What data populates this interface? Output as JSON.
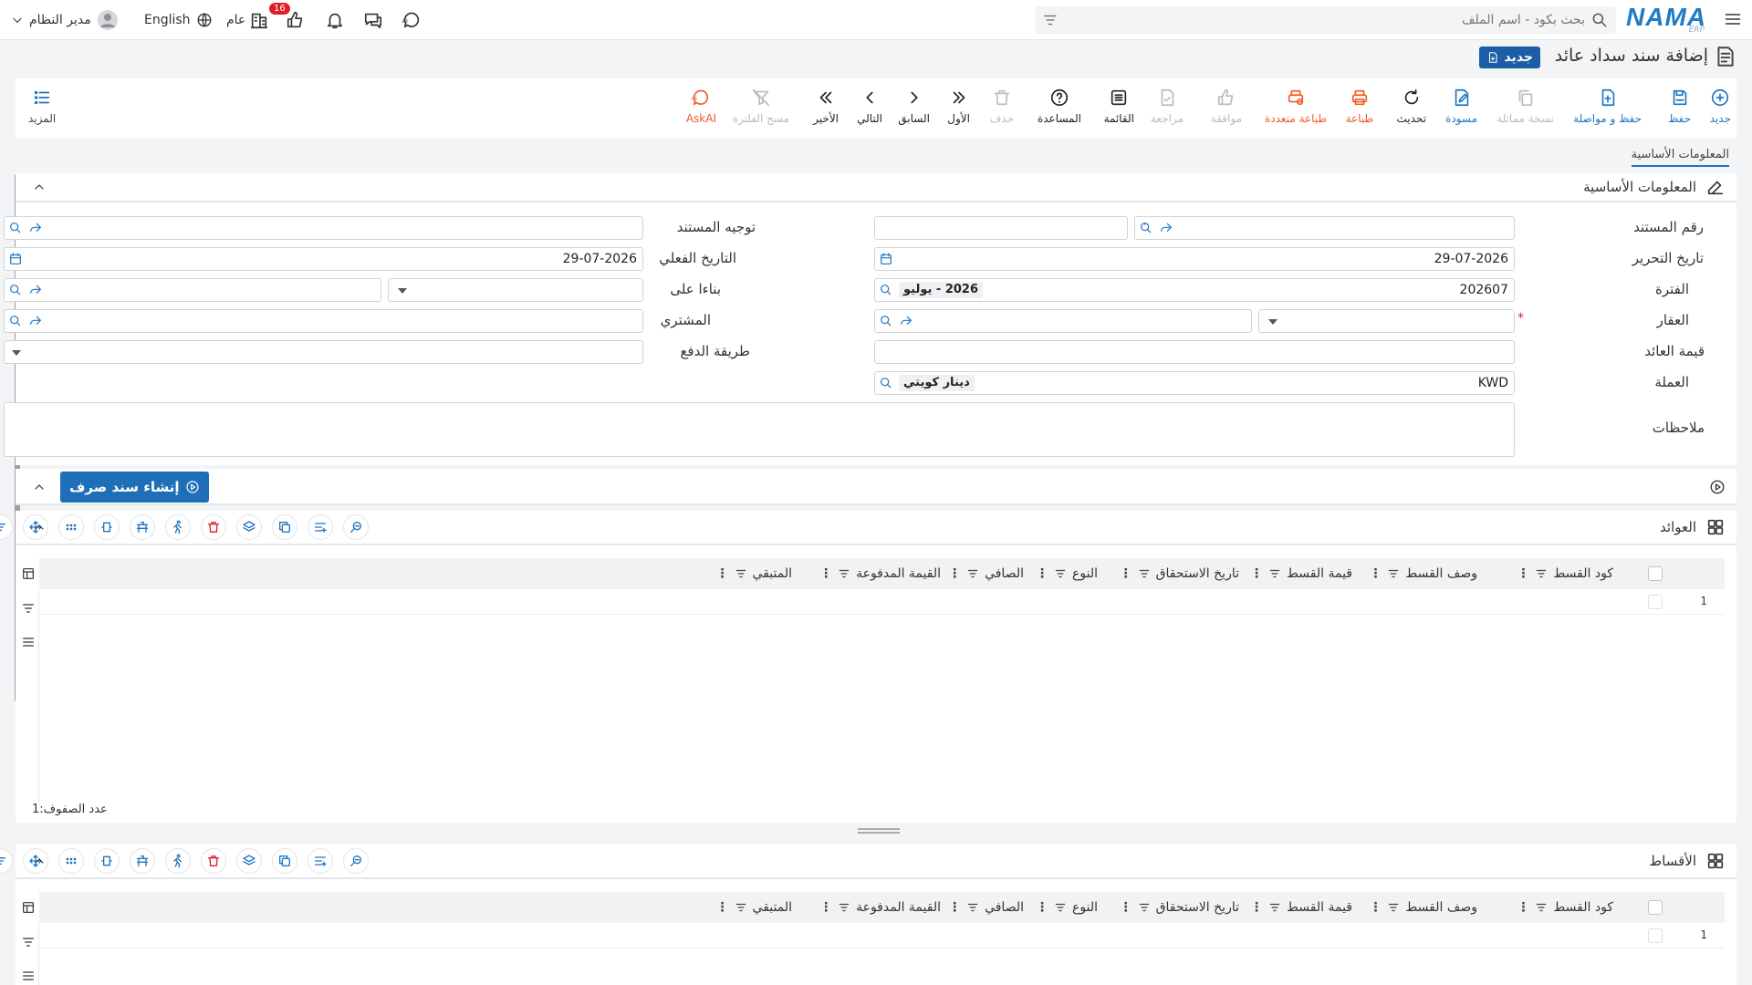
{
  "app": {
    "brand": "NAMA",
    "brand_sub": "ERP"
  },
  "search": {
    "placeholder": "بحث بكود - اسم الملف"
  },
  "topbar": {
    "user": "مدير النظام",
    "language": "English",
    "scope": "عام",
    "notif_count": "16"
  },
  "page": {
    "title": "إضافة سند سداد عائد",
    "status_badge": "جديد"
  },
  "toolbar": {
    "new": "جديد",
    "save": "حفظ",
    "save_continue": "حفظ و مواصلة",
    "copy": "نسخة مماثلة",
    "draft": "مسودة",
    "refresh": "تحديث",
    "print": "طباعة",
    "multi_print": "طباعة متعددة",
    "approve": "موافقة",
    "review": "مراجعة",
    "list": "القائمة",
    "help": "المساعدة",
    "delete": "حذف",
    "first": "الأول",
    "previous": "السابق",
    "next": "التالي",
    "last": "الأخير",
    "clear_filter": "مسح الفلترة",
    "askai": "AskAI",
    "more": "المزيد"
  },
  "tabs": {
    "basic": "المعلومات الأساسية"
  },
  "section": {
    "title": "المعلومات الأساسية"
  },
  "form": {
    "doc_no_label": "رقم المستند",
    "doc_route_label": "توجيه المستند",
    "edit_date_label": "تاريخ التحرير",
    "edit_date": "29-07-2026",
    "actual_date_label": "التاريخ الفعلي",
    "actual_date": "29-07-2026",
    "period_label": "الفترة",
    "period": "202607",
    "period_name": "2026 - يوليو",
    "based_on_label": "بناءا على",
    "property_label": "العقار",
    "required_mark": "*",
    "buyer_label": "المشتري",
    "return_value_label": "قيمة العائد",
    "payment_method_label": "طريقة الدفع",
    "currency_label": "العملة",
    "currency": "KWD",
    "currency_name": "دينار كويتي",
    "notes_label": "ملاحظات"
  },
  "actions": {
    "create_payment": "إنشاء سند صرف"
  },
  "grid_returns": {
    "title": "العوائد",
    "columns": [
      "كود القسط",
      "وصف القسط",
      "قيمة القسط",
      "تاريخ الاستحقاق",
      "النوع",
      "الصافي",
      "القيمة المدفوعة",
      "المتبقي"
    ],
    "rows": [
      {
        "n": "1"
      }
    ],
    "count_label": "عدد الصفوف:",
    "count": "1"
  },
  "grid_installments": {
    "title": "الأقساط",
    "columns": [
      "كود القسط",
      "وصف القسط",
      "قيمة القسط",
      "تاريخ الاستحقاق",
      "النوع",
      "الصافي",
      "القيمة المدفوعة",
      "المتبقي"
    ],
    "rows": [
      {
        "n": "1"
      }
    ]
  },
  "colors": {
    "accent": "#1f74c0",
    "danger": "#e11d2a",
    "orange": "#f05a28",
    "badge": "#1b5ea6"
  }
}
